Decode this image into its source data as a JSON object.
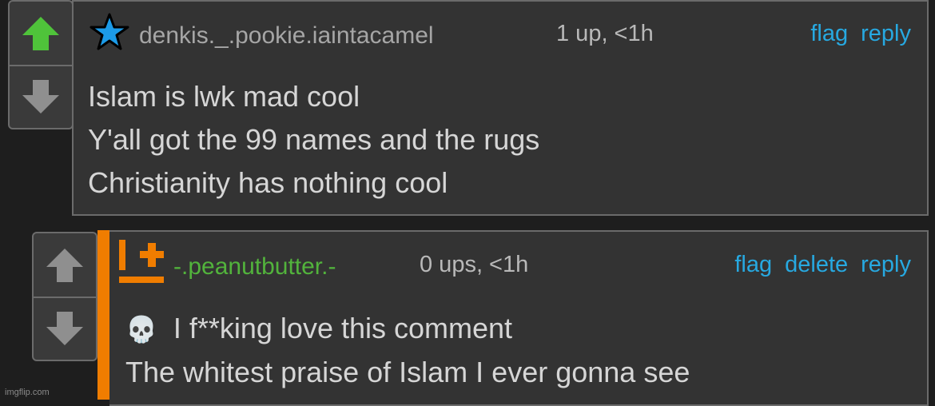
{
  "colors": {
    "link": "#27a9e1",
    "upvote_active": "#4fc33a",
    "vote_inactive": "#8f8f8f",
    "username_1": "#a6a6a6",
    "username_2": "#52b33c",
    "accent_bar": "#f07d00",
    "badge_orange": "#f07d00",
    "star_fill": "#1c9be8"
  },
  "comment1": {
    "username": "denkis._.pookie.iaintacamel",
    "badge_icon": "star-icon",
    "points": "1 up, <1h",
    "actions": {
      "flag": "flag",
      "reply": "reply"
    },
    "lines": [
      "Islam is lwk mad cool",
      "Y'all got the 99 names and the rugs",
      "Christianity has nothing cool"
    ],
    "upvoted": true
  },
  "comment2": {
    "username": "-.peanutbutter.-",
    "badge_icon": "badge-plus-icon",
    "points": "0 ups, <1h",
    "actions": {
      "flag": "flag",
      "delete": "delete",
      "reply": "reply"
    },
    "emoji": "💀",
    "line1": "I f**king love this comment",
    "line2": "The whitest praise of Islam I ever gonna see",
    "upvoted": false
  },
  "watermark": "imgflip.com"
}
